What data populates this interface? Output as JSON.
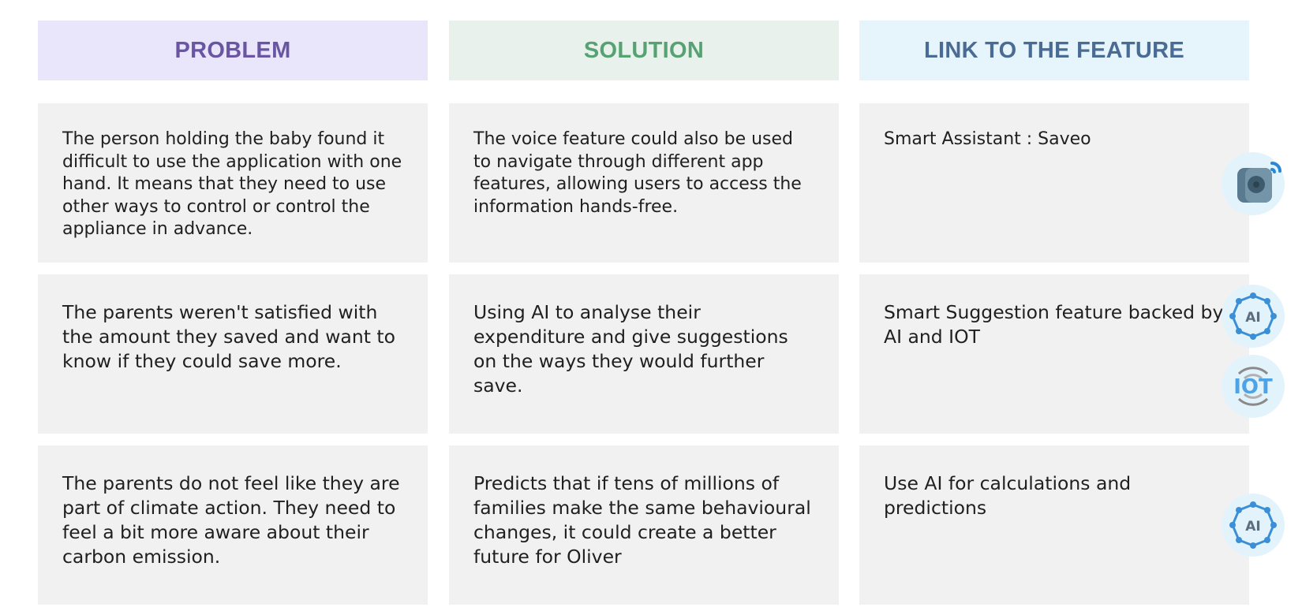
{
  "headers": {
    "problem": "PROBLEM",
    "solution": "SOLUTION",
    "link": "LINK TO THE FEATURE"
  },
  "rows": [
    {
      "problem": "The person holding the baby found it difficult to use the application with one hand. It means that they need to use other ways to control or control the appliance in advance.",
      "solution": "The voice feature could also be used to navigate through different app features, allowing users to access the information hands-free.",
      "link": "Smart Assistant : Saveo"
    },
    {
      "problem": "The parents weren't satisfied with the amount they saved and want to know if they could save more.",
      "solution": "Using AI to analyse their expenditure and give suggestions on the ways they would further save.",
      "link": "Smart Suggestion feature backed by AI and IOT"
    },
    {
      "problem": "The parents do not feel like they are part of climate action. They need to feel a bit more aware about their carbon emission.",
      "solution": "Predicts that if tens of millions of families make the same behavioural changes, it could create a better future for Oliver",
      "link": "Use AI for calculations and predictions"
    }
  ],
  "icons": {
    "ai_label": "AI",
    "iot_label": "IOT"
  },
  "colors": {
    "problem_header": "#6a55a3",
    "solution_header": "#57a273",
    "link_header": "#4a6b94",
    "cell_bg": "#f1f1f1",
    "icon_blue": "#3b8fd6"
  }
}
